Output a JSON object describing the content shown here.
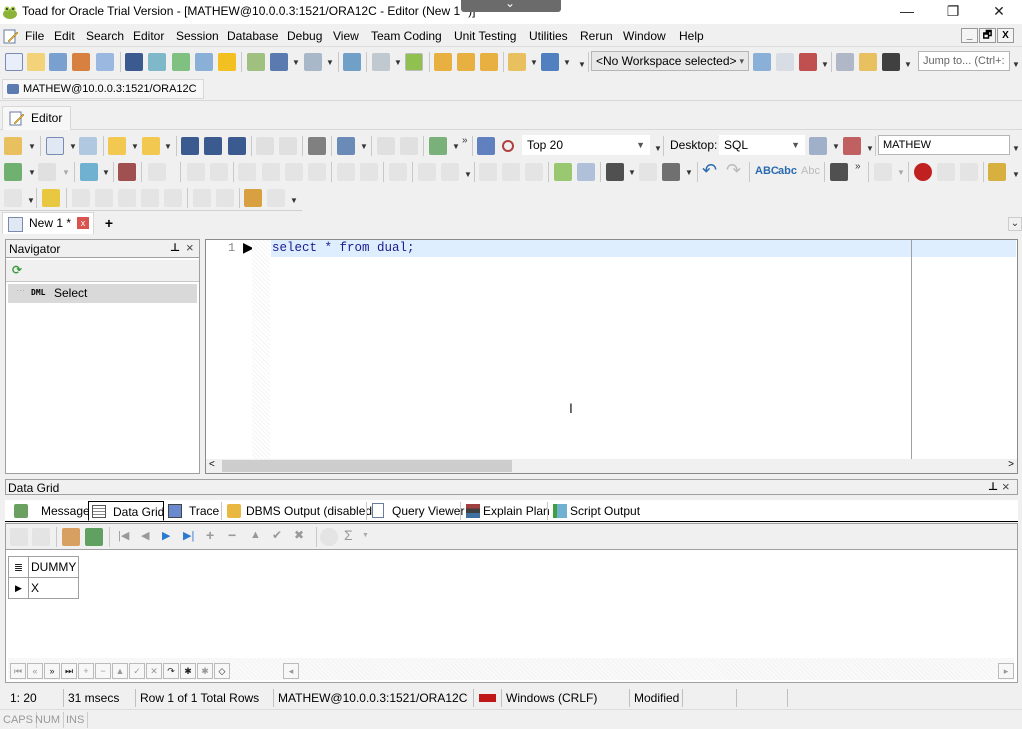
{
  "window": {
    "title": "Toad for Oracle Trial Version - [MATHEW@10.0.0.3:1521/ORA12C - Editor (New 1 *)]",
    "minimize": "—",
    "maximize": "❐",
    "close": "✕",
    "collapse_glyph": "⌄"
  },
  "menu": {
    "items": [
      "File",
      "Edit",
      "Search",
      "Editor",
      "Session",
      "Database",
      "Debug",
      "View",
      "Team Coding",
      "Unit Testing",
      "Utilities",
      "Rerun",
      "Window",
      "Help"
    ],
    "mdi": [
      "_",
      "🗗",
      "X"
    ]
  },
  "main_toolbar": {
    "workspace_select": "<No Workspace selected>",
    "jump_to_placeholder": "Jump to... (Ctrl+:"
  },
  "connection": {
    "label": "MATHEW@10.0.0.3:1521/ORA12C"
  },
  "editor_window_tab": {
    "label": "Editor"
  },
  "editor_toolbar": {
    "top_rows_select": "Top 20",
    "desktop_label": "Desktop:",
    "desktop_select": "SQL",
    "schema_input": "MATHEW"
  },
  "doc_tabs": {
    "active": "New 1 *",
    "add_label": "+"
  },
  "navigator": {
    "title": "Navigator",
    "pin": "📌",
    "close": "×",
    "items": [
      {
        "tag": "DML",
        "label": "Select"
      }
    ]
  },
  "editor": {
    "line_numbers": [
      "1"
    ],
    "code": "select * from dual;"
  },
  "data_grid_panel": {
    "title": "Data Grid",
    "tabs": [
      "Messages",
      "Data Grid",
      "Trace",
      "DBMS Output (disabled)",
      "Query Viewer",
      "Explain Plan",
      "Script Output"
    ],
    "active_tab": "Data Grid",
    "columns": [
      "DUMMY"
    ],
    "rows": [
      [
        "X"
      ]
    ]
  },
  "status": {
    "cursor": "1:  20",
    "elapsed": "31 msecs",
    "rows": "Row 1 of 1 Total Rows",
    "connection": "MATHEW@10.0.0.3:1521/ORA12C",
    "line_endings": "Windows (CRLF)",
    "modified": "Modified",
    "caps": "CAPS",
    "num": "NUM",
    "ins": "INS"
  },
  "colors": {
    "accent_blue": "#1c1c8c",
    "line_highlight": "#dfeeff",
    "close_red": "#d9534f"
  }
}
